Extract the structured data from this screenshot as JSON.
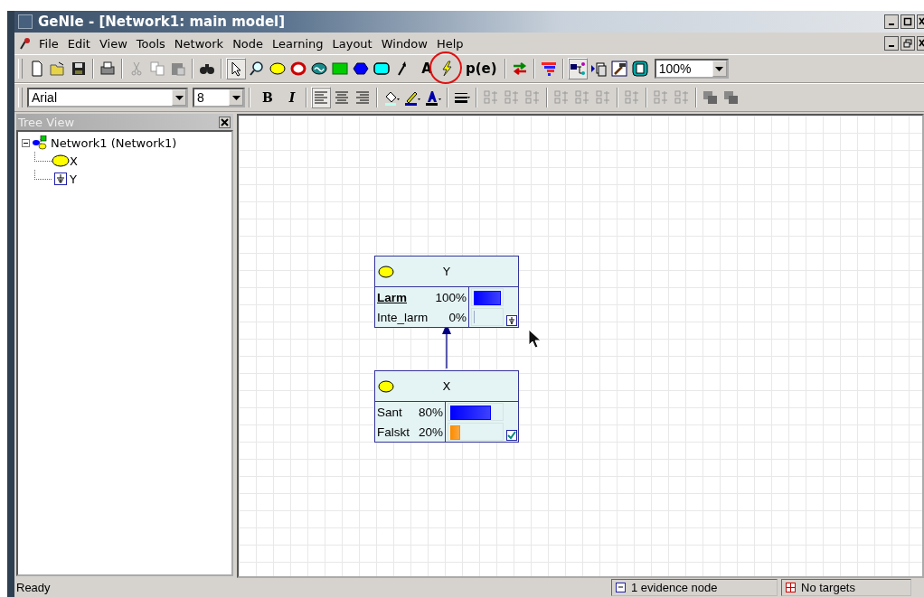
{
  "window": {
    "title": "GeNIe - [Network1: main model]"
  },
  "menu": [
    "File",
    "Edit",
    "View",
    "Tools",
    "Network",
    "Node",
    "Learning",
    "Layout",
    "Window",
    "Help"
  ],
  "toolbar": [
    {
      "kind": "new",
      "selected": false
    },
    {
      "kind": "open",
      "selected": false
    },
    {
      "kind": "save",
      "selected": false
    },
    {
      "kind": "sep"
    },
    {
      "kind": "print",
      "selected": false
    },
    {
      "kind": "sep"
    },
    {
      "kind": "cut",
      "selected": false
    },
    {
      "kind": "copy",
      "selected": false
    },
    {
      "kind": "paste",
      "selected": false
    },
    {
      "kind": "sep"
    },
    {
      "kind": "find",
      "selected": false
    },
    {
      "kind": "sep"
    },
    {
      "kind": "pointer",
      "selected": true
    },
    {
      "kind": "zoom",
      "selected": false
    },
    {
      "kind": "chance",
      "selected": false
    },
    {
      "kind": "deterministic",
      "selected": false
    },
    {
      "kind": "equation",
      "selected": false
    },
    {
      "kind": "decision",
      "selected": false
    },
    {
      "kind": "utility",
      "selected": false
    },
    {
      "kind": "submodel",
      "selected": false
    },
    {
      "kind": "arc",
      "selected": false
    },
    {
      "kind": "text",
      "label": "A",
      "selected": false
    },
    {
      "kind": "update",
      "selected": false,
      "circled": true
    },
    {
      "kind": "text",
      "label": "p(e)",
      "selected": false
    },
    {
      "kind": "sep"
    },
    {
      "kind": "swap",
      "selected": false
    },
    {
      "kind": "sep"
    },
    {
      "kind": "sort",
      "selected": false
    },
    {
      "kind": "sep"
    },
    {
      "kind": "graph",
      "selected": true
    },
    {
      "kind": "pages",
      "selected": false
    },
    {
      "kind": "hammer",
      "selected": false
    },
    {
      "kind": "sheet",
      "selected": false
    }
  ],
  "zoom": {
    "value": "100%"
  },
  "format_bar": {
    "font": "Arial",
    "size": "8",
    "buttons": [
      {
        "kind": "sep"
      },
      {
        "kind": "text",
        "label": "B",
        "selected": false
      },
      {
        "kind": "text",
        "label": "I",
        "selected": false
      },
      {
        "kind": "sep"
      },
      {
        "kind": "align-left",
        "selected": true
      },
      {
        "kind": "align-center",
        "selected": false
      },
      {
        "kind": "align-right",
        "selected": false
      },
      {
        "kind": "sep"
      },
      {
        "kind": "fill-color",
        "selected": false
      },
      {
        "kind": "line-color",
        "selected": false
      },
      {
        "kind": "font-color",
        "selected": false
      },
      {
        "kind": "sep"
      },
      {
        "kind": "line-width",
        "selected": false
      },
      {
        "kind": "sep"
      },
      {
        "kind": "layout",
        "selected": false
      },
      {
        "kind": "layout",
        "selected": false
      },
      {
        "kind": "layout",
        "selected": false
      },
      {
        "kind": "sep"
      },
      {
        "kind": "layout",
        "selected": false
      },
      {
        "kind": "layout",
        "selected": false
      },
      {
        "kind": "layout",
        "selected": false
      },
      {
        "kind": "sep"
      },
      {
        "kind": "layout",
        "selected": false
      },
      {
        "kind": "sep"
      },
      {
        "kind": "layout",
        "selected": false
      },
      {
        "kind": "layout",
        "selected": false
      },
      {
        "kind": "sep"
      },
      {
        "kind": "layers",
        "selected": false
      },
      {
        "kind": "layers",
        "selected": false
      }
    ]
  },
  "tree_view": {
    "title": "Tree View",
    "items": [
      {
        "label": "Network1 (Network1)",
        "kind": "network",
        "expanded": true,
        "children": [
          {
            "label": "X",
            "kind": "chance"
          },
          {
            "label": "Y",
            "kind": "evidence"
          }
        ]
      }
    ]
  },
  "nodes": [
    {
      "name": "Y",
      "evidence": true,
      "updated": false,
      "states": [
        {
          "name": "Larm",
          "value": "100%",
          "level": 1,
          "evidence": true,
          "color": "#0000ff"
        },
        {
          "name": "Inte_larm",
          "value": "0%",
          "level": 0,
          "evidence": false
        }
      ]
    },
    {
      "name": "X",
      "evidence": false,
      "updated": true,
      "states": [
        {
          "name": "Sant",
          "value": "80%",
          "level": 0.8,
          "evidence": false,
          "color": "#0000ff"
        },
        {
          "name": "Falskt",
          "value": "20%",
          "level": 0.2,
          "evidence": false,
          "color": "#ff8c00"
        }
      ]
    }
  ],
  "status_bar": {
    "message": "Ready",
    "evidence": "1 evidence node",
    "targets": "No targets"
  }
}
